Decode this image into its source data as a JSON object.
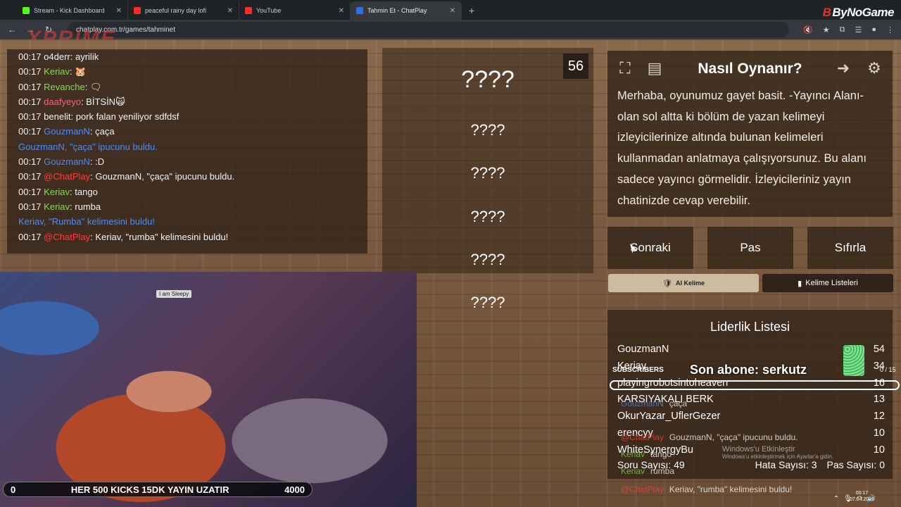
{
  "browser": {
    "tabs": [
      {
        "label": "Stream - Kick Dashboard",
        "color": "#53fc18"
      },
      {
        "label": "peaceful rainy day lofi",
        "color": "#ff2b2b"
      },
      {
        "label": "YouTube",
        "color": "#ff2b2b"
      },
      {
        "label": "Tahmin Et - ChatPlay",
        "color": "#2f6fe0"
      }
    ],
    "new_tab": "+",
    "url": "chatplay.com.tr/games/tahminet",
    "brand": "ByNoGame",
    "brand_mark": "B"
  },
  "overlay_logo": "XPRIME",
  "chat": [
    {
      "time": "00:17",
      "user": "o4derr",
      "sep": ": ",
      "msg": "ayrilik",
      "color": "#f3f3f3"
    },
    {
      "time": "00:17",
      "user": "Keriav",
      "sep": ": ",
      "msg": "🐹",
      "color": "#7ee04a"
    },
    {
      "time": "00:17",
      "user": "Revanche",
      "sep": ": ",
      "msg": "🗨",
      "color": "#7ee04a"
    },
    {
      "time": "00:17",
      "user": "daafyeyo",
      "sep": ": ",
      "msg": "BİTSİN🙀",
      "color": "#ff5f7a"
    },
    {
      "time": "00:17",
      "user": "benelit",
      "sep": ": ",
      "msg": "pork falan yeniliyor sdfdsf",
      "color": "#f3f3f3"
    },
    {
      "time": "00:17",
      "user": "GouzmanN",
      "sep": ": ",
      "msg": "çaça",
      "color": "#4f8cf0"
    },
    {
      "time": "",
      "user": "GouzmanN, ",
      "sep": "",
      "msg": "\"çaça\" ipucunu buldu.",
      "color": "#4f8cf0",
      "msg_color": "#4f8cf0"
    },
    {
      "time": "00:17",
      "user": "GouzmanN",
      "sep": ": ",
      "msg": ":D",
      "color": "#4f8cf0"
    },
    {
      "time": "00:17",
      "user": "@ChatPlay",
      "sep": ": ",
      "msg": "GouzmanN, \"çaça\" ipucunu buldu.",
      "color": "#ff3b3b"
    },
    {
      "time": "00:17",
      "user": "Keriav",
      "sep": ": ",
      "msg": "tango",
      "color": "#7ee04a"
    },
    {
      "time": "00:17",
      "user": "Keriav",
      "sep": ": ",
      "msg": "rumba",
      "color": "#7ee04a"
    },
    {
      "time": "",
      "user": "Keriav, ",
      "sep": "",
      "msg": "\"Rumba\" kelimesini buldu!",
      "color": "#4f8cf0",
      "msg_color": "#4f8cf0"
    },
    {
      "time": "00:17",
      "user": "@ChatPlay",
      "sep": ": ",
      "msg": "Keriav, \"rumba\" kelimesini buldu!",
      "color": "#ff3b3b"
    }
  ],
  "words": {
    "counter": "56",
    "main": "????",
    "hints": [
      "????",
      "????",
      "????",
      "????",
      "????"
    ]
  },
  "howto": {
    "title": "Nasıl Oynanır?",
    "text": "Merhaba, oyunumuz gayet basit. -Yayıncı Alanı- olan sol altta ki bölüm de yazan kelimeyi izleyicilerinize altında bulunan kelimeleri kullanmadan anlatmaya çalışıyorsunuz. Bu alanı sadece yayıncı görmelidir. İzleyicileriniz yayın chatinizde cevap verebilir."
  },
  "actions": {
    "next": "Sonraki",
    "pass": "Pas",
    "reset": "Sıfırla",
    "ai_word": "AI Kelime",
    "word_lists": "Kelime Listeleri"
  },
  "leaderboard": {
    "title": "Liderlik Listesi",
    "rows": [
      {
        "name": "GouzmanN",
        "score": "54"
      },
      {
        "name": "Keriav",
        "score": "34"
      },
      {
        "name": "playingrobotsintoheaven",
        "score": "16"
      },
      {
        "name": "KARSIYAKALI BERK",
        "score": "13"
      },
      {
        "name": "OkurYazar_UflerGezer",
        "score": "12"
      },
      {
        "name": "erencyy",
        "score": "10"
      },
      {
        "name": "WhiteSynergyBu",
        "score": "10"
      }
    ],
    "question_count": "Soru Sayısı: 49",
    "error_count": "Hata Sayısı: 3",
    "pass_count": "Pas Sayısı: 0"
  },
  "overlays": {
    "subscribers_label": "SUBSCRIBERS",
    "subscribers_count": "0 / 15",
    "last_sub": "Son abone: serkutz",
    "chat_lines": [
      {
        "user": "GouzmanN",
        "msg": "çaça",
        "user_color": "#4f8cf0"
      },
      {
        "user": "@ChatPlay",
        "msg": "GouzmanN, \"çaça\" ipucunu buldu.",
        "user_color": "#ff3b3b"
      },
      {
        "user": "Keriav",
        "msg": "tango",
        "user_color": "#7ee04a"
      },
      {
        "user": "Keriav",
        "msg": "rumba",
        "user_color": "#7ee04a"
      },
      {
        "user": "@ChatPlay",
        "msg": "Keriav, \"rumba\" kelimesini buldu!",
        "user_color": "#ff3b3b"
      }
    ],
    "watermark_title": "Windows'u Etkinleştir",
    "watermark_sub": "Windows'u etkinleştirmek için Ayarlar'a gidin.",
    "clock_time": "00:17",
    "clock_date": "07.04.2026"
  },
  "ticker": {
    "left": "0",
    "text": "HER 500 KICKS 15DK YAYIN UZATIR",
    "right": "4000"
  },
  "cam_sign": "I am Sleepy"
}
